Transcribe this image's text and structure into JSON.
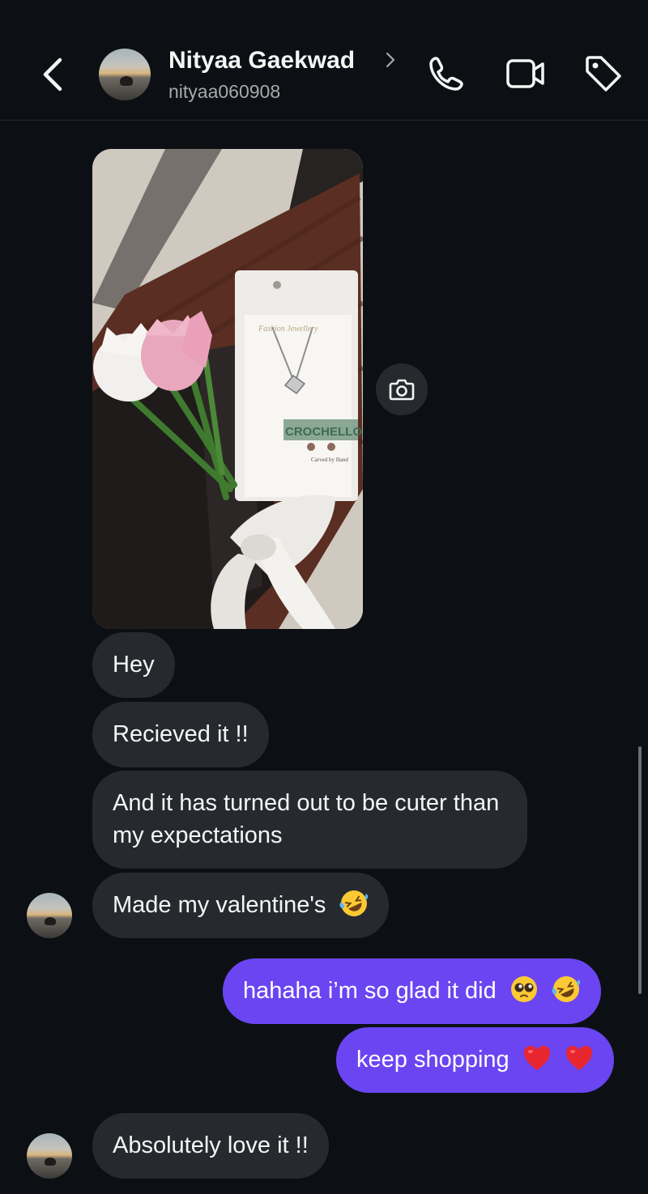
{
  "header": {
    "name": "Nityaa Gaekwad",
    "username": "nityaa060908",
    "icons": [
      "back-chevron-icon",
      "phone-icon",
      "video-camera-icon",
      "tag-icon"
    ]
  },
  "photo": {
    "package_brand": "CROCHELLO",
    "package_subtitle": "Carved by Hand",
    "package_top_text": "Fashion Jewellery"
  },
  "messages": [
    {
      "side": "in",
      "text": "Hey"
    },
    {
      "side": "in",
      "text": "Recieved it !!"
    },
    {
      "side": "in",
      "text": "And it has turned out to be cuter than my expectations"
    },
    {
      "side": "in",
      "text": "Made my valentine's"
    },
    {
      "side": "out",
      "text": "hahaha i’m so glad it did"
    },
    {
      "side": "out",
      "text": "keep shopping"
    },
    {
      "side": "in",
      "text": "Absolutely love it !!"
    }
  ],
  "colors": {
    "background": "#0c1014",
    "incoming_bubble": "#262a2f",
    "outgoing_bubble": "#6b45f2"
  }
}
